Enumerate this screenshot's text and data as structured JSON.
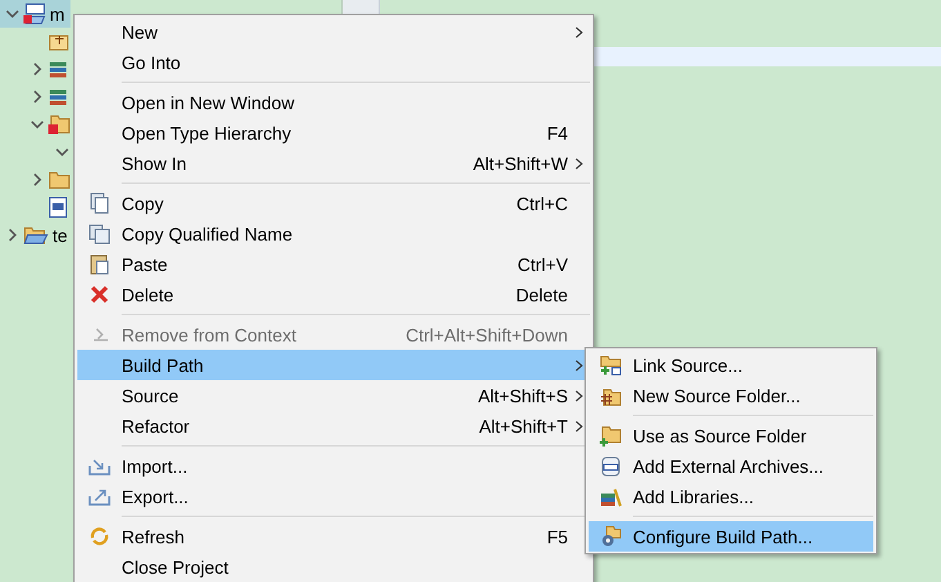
{
  "tree": [
    {
      "kind": "project",
      "label": "m",
      "expanded": true,
      "selected": true,
      "children": [
        {
          "kind": "package"
        },
        {
          "kind": "library",
          "expanded": false
        },
        {
          "kind": "library",
          "expanded": false
        },
        {
          "kind": "error-folder",
          "expanded": true,
          "children": [
            {
              "expanded": true
            }
          ]
        },
        {
          "kind": "folder",
          "expanded": false
        },
        {
          "kind": "file"
        }
      ]
    },
    {
      "kind": "open-folder",
      "label": "te",
      "expanded": false,
      "selected": false
    }
  ],
  "context_menu": {
    "sections": [
      [
        {
          "label": "New",
          "submenu": true,
          "disabled": false,
          "selected": false
        },
        {
          "label": "Go Into",
          "submenu": false,
          "disabled": false,
          "selected": false
        }
      ],
      [
        {
          "label": "Open in New Window",
          "submenu": false,
          "disabled": false,
          "selected": false
        },
        {
          "label": "Open Type Hierarchy",
          "shortcut": "F4",
          "submenu": false,
          "disabled": false,
          "selected": false
        },
        {
          "label": "Show In",
          "shortcut": "Alt+Shift+W",
          "submenu": true,
          "disabled": false,
          "selected": false
        }
      ],
      [
        {
          "label": "Copy",
          "shortcut": "Ctrl+C",
          "submenu": false,
          "disabled": false,
          "selected": false
        },
        {
          "label": "Copy Qualified Name",
          "submenu": false,
          "disabled": false,
          "selected": false
        },
        {
          "label": "Paste",
          "shortcut": "Ctrl+V",
          "submenu": false,
          "disabled": false,
          "selected": false
        },
        {
          "label": "Delete",
          "shortcut": "Delete",
          "submenu": false,
          "disabled": false,
          "selected": false
        }
      ],
      [
        {
          "label": "Remove from Context",
          "shortcut": "Ctrl+Alt+Shift+Down",
          "submenu": false,
          "disabled": true,
          "selected": false
        },
        {
          "label": "Build Path",
          "submenu": true,
          "disabled": false,
          "selected": true
        },
        {
          "label": "Source",
          "shortcut": "Alt+Shift+S",
          "submenu": true,
          "disabled": false,
          "selected": false
        },
        {
          "label": "Refactor",
          "shortcut": "Alt+Shift+T",
          "submenu": true,
          "disabled": false,
          "selected": false
        }
      ],
      [
        {
          "label": "Import...",
          "submenu": false,
          "disabled": false,
          "selected": false
        },
        {
          "label": "Export...",
          "submenu": false,
          "disabled": false,
          "selected": false
        }
      ],
      [
        {
          "label": "Refresh",
          "shortcut": "F5",
          "submenu": false,
          "disabled": false,
          "selected": false
        },
        {
          "label": "Close Project",
          "submenu": false,
          "disabled": false,
          "selected": false
        }
      ]
    ]
  },
  "submenu": {
    "sections": [
      [
        {
          "label": "Link Source...",
          "selected": false
        },
        {
          "label": "New Source Folder...",
          "selected": false
        }
      ],
      [
        {
          "label": "Use as Source Folder",
          "selected": false
        },
        {
          "label": "Add External Archives...",
          "selected": false
        },
        {
          "label": "Add Libraries...",
          "selected": false
        }
      ],
      [
        {
          "label": "Configure Build Path...",
          "selected": true
        }
      ]
    ]
  }
}
